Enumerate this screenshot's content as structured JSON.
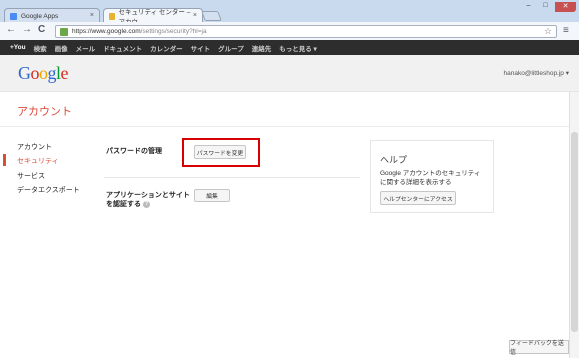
{
  "browser": {
    "tabs": [
      {
        "label": "Google Apps",
        "active": false
      },
      {
        "label": "セキュリティ センター – アカウ…",
        "active": true
      }
    ],
    "window_controls": {
      "minimize": "–",
      "maximize": "□",
      "close": "✕"
    },
    "url_host": "https://www.google.com",
    "url_path": "/settings/security?hl=ja",
    "nav": {
      "back": "←",
      "forward": "→",
      "reload": "C"
    },
    "star_icon": "☆",
    "wrench_icon": "🔧"
  },
  "gbar": {
    "items": [
      "+You",
      "検索",
      "画像",
      "メール",
      "ドキュメント",
      "カレンダー",
      "サイト",
      "グループ",
      "連絡先",
      "もっと見る ▾"
    ]
  },
  "header": {
    "logo": [
      "G",
      "o",
      "o",
      "g",
      "l",
      "e"
    ],
    "account_email": "hanako@littleshop.jp ▾"
  },
  "page": {
    "title": "アカウント"
  },
  "sidebar": {
    "items": [
      {
        "label": "アカウント",
        "active": false
      },
      {
        "label": "セキュリティ",
        "active": true
      },
      {
        "label": "サービス",
        "active": false
      },
      {
        "label": "データエクスポート",
        "active": false
      }
    ]
  },
  "main": {
    "password_label": "パスワードの管理",
    "password_button": "パスワードを変更",
    "apps_label_line1": "アプリケーションとサイト",
    "apps_label_line2": "を認証する",
    "apps_help": "?",
    "apps_button": "編集"
  },
  "help": {
    "title": "ヘルプ",
    "text_line1": "Google アカウントのセキュリティ",
    "text_line2": "に関する詳細を表示する",
    "button": "ヘルプセンターにアクセス"
  },
  "feedback_button": "フィードバックを送信",
  "colors": {
    "accent": "#dd4b39",
    "highlight": "#d80000",
    "gbar": "#2d2d2d"
  }
}
